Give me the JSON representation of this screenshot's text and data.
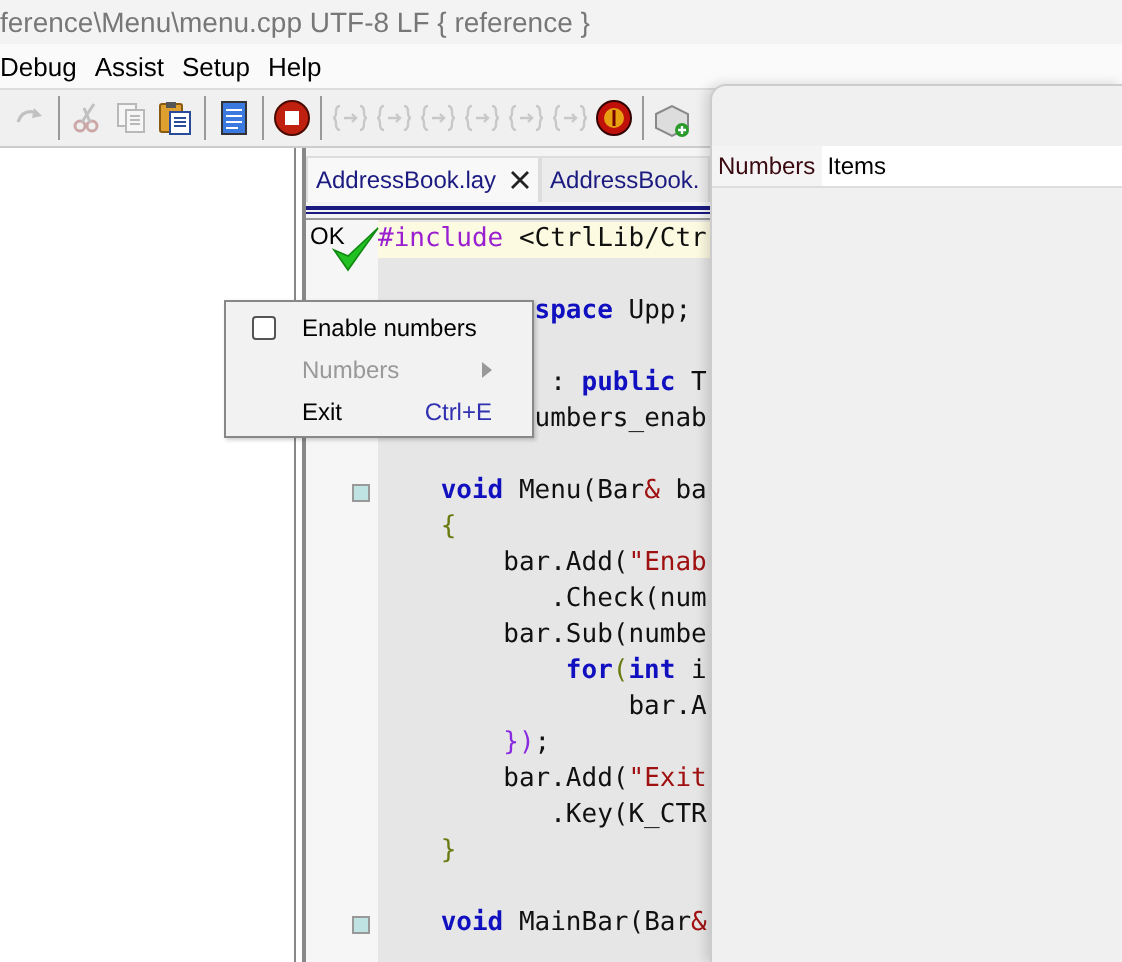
{
  "window": {
    "title": "ference\\Menu\\menu.cpp UTF-8 LF { reference }"
  },
  "menu_bar": [
    "Debug",
    "Assist",
    "Setup",
    "Help"
  ],
  "toolbar": [
    {
      "kind": "redo",
      "disabled": true
    },
    {
      "kind": "sep"
    },
    {
      "kind": "cut",
      "disabled": true
    },
    {
      "kind": "copy",
      "disabled": true
    },
    {
      "kind": "paste",
      "disabled": false
    },
    {
      "kind": "sep"
    },
    {
      "kind": "document",
      "disabled": false
    },
    {
      "kind": "sep"
    },
    {
      "kind": "stop",
      "disabled": false
    },
    {
      "kind": "sep"
    },
    {
      "kind": "step",
      "disabled": true
    },
    {
      "kind": "step",
      "disabled": true
    },
    {
      "kind": "step",
      "disabled": true
    },
    {
      "kind": "step",
      "disabled": true
    },
    {
      "kind": "step",
      "disabled": true
    },
    {
      "kind": "step",
      "disabled": true
    },
    {
      "kind": "coin",
      "disabled": false
    },
    {
      "kind": "sep"
    },
    {
      "kind": "package",
      "disabled": false
    }
  ],
  "tabs": [
    {
      "label": "AddressBook.lay",
      "selected": true,
      "closable": true
    },
    {
      "label": "AddressBook.",
      "selected": false
    }
  ],
  "build_status": "OK",
  "code_lines": [
    {
      "kind": "code",
      "current": true,
      "parts": [
        {
          "text": "#include",
          "kind": "pre"
        },
        {
          "text": " <CtrlLib/Ctr",
          "kind": "plain"
        }
      ]
    },
    {
      "kind": "blank"
    },
    {
      "kind": "code",
      "parts": [
        {
          "text": "          space",
          "kind": "kw"
        },
        {
          "text": " Upp;",
          "kind": "plain"
        }
      ]
    },
    {
      "kind": "blank"
    },
    {
      "kind": "code",
      "parts": [
        {
          "text": "           : ",
          "kind": "plain"
        },
        {
          "text": "public",
          "kind": "kw"
        },
        {
          "text": " T",
          "kind": "plain"
        }
      ]
    },
    {
      "kind": "code",
      "parts": [
        {
          "text": "          umbers_enab",
          "kind": "plain"
        }
      ]
    },
    {
      "kind": "blank"
    },
    {
      "kind": "code",
      "marker": true,
      "parts": [
        {
          "text": "    void",
          "kind": "kw"
        },
        {
          "text": " Menu(Bar",
          "kind": "plain"
        },
        {
          "text": "&",
          "kind": "op"
        },
        {
          "text": " ba",
          "kind": "plain"
        }
      ]
    },
    {
      "kind": "code",
      "parts": [
        {
          "text": "    {",
          "kind": "brace"
        }
      ]
    },
    {
      "kind": "code",
      "parts": [
        {
          "text": "        bar.Add(",
          "kind": "plain"
        },
        {
          "text": "\"Enab",
          "kind": "str"
        }
      ]
    },
    {
      "kind": "code",
      "parts": [
        {
          "text": "           .Check(num",
          "kind": "plain"
        }
      ]
    },
    {
      "kind": "code",
      "parts": [
        {
          "text": "        bar.Sub(numbe",
          "kind": "plain"
        }
      ]
    },
    {
      "kind": "code",
      "parts": [
        {
          "text": "            for",
          "kind": "kw"
        },
        {
          "text": "(",
          "kind": "brace"
        },
        {
          "text": "int",
          "kind": "kw"
        },
        {
          "text": " i",
          "kind": "plain"
        }
      ]
    },
    {
      "kind": "code",
      "parts": [
        {
          "text": "                bar.A",
          "kind": "plain"
        }
      ]
    },
    {
      "kind": "code",
      "parts": [
        {
          "text": "        })",
          "kind": "brace2"
        },
        {
          "text": ";",
          "kind": "plain"
        }
      ]
    },
    {
      "kind": "code",
      "parts": [
        {
          "text": "        bar.Add(",
          "kind": "plain"
        },
        {
          "text": "\"Exit",
          "kind": "str"
        }
      ]
    },
    {
      "kind": "code",
      "parts": [
        {
          "text": "           .Key(K_CTR",
          "kind": "plain"
        }
      ]
    },
    {
      "kind": "code",
      "parts": [
        {
          "text": "    }",
          "kind": "brace"
        }
      ]
    },
    {
      "kind": "blank"
    },
    {
      "kind": "code",
      "marker": true,
      "parts": [
        {
          "text": "    void",
          "kind": "kw"
        },
        {
          "text": " MainBar(Bar",
          "kind": "plain"
        },
        {
          "text": "&",
          "kind": "op"
        }
      ]
    }
  ],
  "popup_menu": [
    {
      "kind": "check",
      "label": "Enable numbers",
      "checked": false,
      "disabled": false
    },
    {
      "kind": "submenu",
      "label": "Numbers",
      "disabled": true
    },
    {
      "kind": "command",
      "label": "Exit",
      "shortcut": "Ctrl+E",
      "disabled": false
    }
  ],
  "app_window": {
    "menu_bar": [
      {
        "label": "Numbers",
        "selected": true
      },
      {
        "label": "Items",
        "selected": false
      }
    ]
  }
}
